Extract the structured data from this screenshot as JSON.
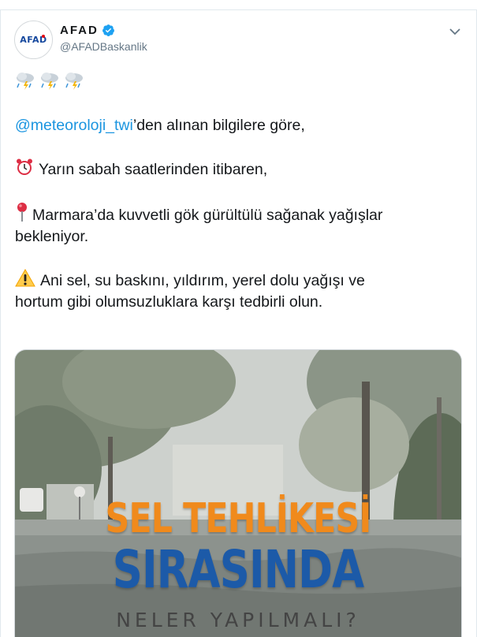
{
  "tweet": {
    "display_name": "AFAD",
    "handle": "@AFADBaskanlik",
    "avatar_text": "AFAD",
    "verified": true,
    "weather_emojis": [
      "cloud-rain-lightning-icon",
      "cloud-rain-lightning-icon",
      "cloud-rain-lightning-icon"
    ],
    "lines": {
      "mention": "@meteoroloji_twi",
      "line1_rest": "’den alınan bilgilere göre,",
      "line2": "Yarın sabah saatlerinden itibaren,",
      "line3a": "Marmara’da kuvvetli gök gürültülü sağanak yağışlar",
      "line3b": "bekleniyor.",
      "line4a": "Ani sel, su baskını, yıldırım, yerel dolu yağışı ve",
      "line4b": "hortum gibi olumsuzluklara karşı tedbirli olun."
    },
    "media": {
      "headline_1": "SEL TEHLİKESİ",
      "headline_2": "SIRASINDA",
      "headline_3": "NELER YAPILMALI?"
    }
  },
  "colors": {
    "link": "#1b95e0",
    "verified": "#1da1f2",
    "headline_orange": "#f08a1c",
    "headline_blue": "#1c5aa8"
  }
}
